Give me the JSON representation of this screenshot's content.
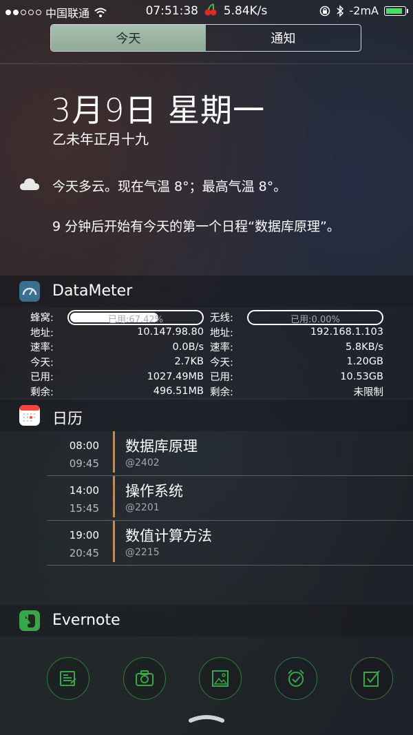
{
  "status_bar": {
    "carrier": "中国联通",
    "time": "07:51:38",
    "speed": "5.84K/s",
    "battery_text": "-2mA",
    "signal_filled": 2,
    "signal_total": 5,
    "battery_level": 0.9,
    "colors": {
      "battery": "#4cd964"
    }
  },
  "tabs": {
    "today": "今天",
    "notifications": "通知"
  },
  "today": {
    "date": "3月9日 星期一",
    "lunar": "乙未年正月十九",
    "weather": "今天多云。现在气温 8°；最高气温 8°。",
    "schedule": "9 分钟后开始有今天的第一个日程“数据库原理”。"
  },
  "datameter": {
    "title": "DataMeter",
    "cell_label": "蜂窝:",
    "cell_usage": "已用:67.42%",
    "cell_usage_fraction": 0.6742,
    "wifi_label": "无线:",
    "wifi_usage": "已用:0.00%",
    "wifi_usage_fraction": 0.0,
    "left": [
      {
        "k": "地址:",
        "v": "10.147.98.80"
      },
      {
        "k": "速率:",
        "v": "0.0B/s"
      },
      {
        "k": "今天:",
        "v": "2.7KB"
      },
      {
        "k": "已用:",
        "v": "1027.49MB"
      },
      {
        "k": "剩余:",
        "v": "496.51MB"
      }
    ],
    "right": [
      {
        "k": "地址:",
        "v": "192.168.1.103"
      },
      {
        "k": "速率:",
        "v": "5.8KB/s"
      },
      {
        "k": "今天:",
        "v": "1.20GB"
      },
      {
        "k": "已用:",
        "v": "10.53GB"
      },
      {
        "k": "剩余:",
        "v": "未限制"
      }
    ]
  },
  "calendar": {
    "title": "日历",
    "events": [
      {
        "start": "08:00",
        "end": "09:45",
        "title": "数据库原理",
        "location": "@2402"
      },
      {
        "start": "14:00",
        "end": "15:45",
        "title": "操作系统",
        "location": "@2201"
      },
      {
        "start": "19:00",
        "end": "20:45",
        "title": "数值计算方法",
        "location": "@2215"
      }
    ],
    "colors": {
      "event_bar": "#b58f6a"
    }
  },
  "evernote": {
    "title": "Evernote",
    "actions": [
      "note-icon",
      "camera-icon",
      "photo-icon",
      "alarm-icon",
      "checklist-icon"
    ],
    "colors": {
      "accent": "#3aa64a"
    }
  }
}
